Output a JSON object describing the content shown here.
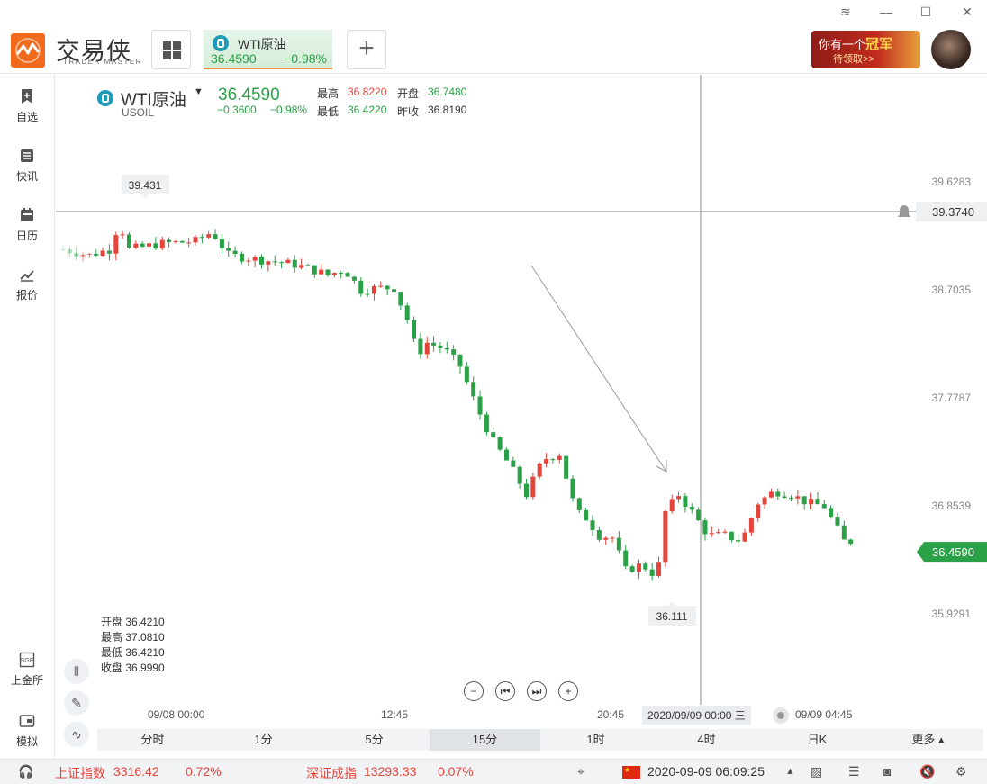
{
  "app": {
    "logo_cn": "交易侠",
    "logo_en": "TRADER MASTER"
  },
  "tab": {
    "name": "WTI原油",
    "price": "36.4590",
    "change_pct": "−0.98%"
  },
  "promo": {
    "line1_a": "你有一个",
    "line1_b": "冠军",
    "line2": "待领取>>"
  },
  "sidebar": {
    "items": [
      {
        "label": "自选",
        "icon": "bookmark-icon"
      },
      {
        "label": "快讯",
        "icon": "news-icon"
      },
      {
        "label": "日历",
        "icon": "calendar-icon"
      },
      {
        "label": "报价",
        "icon": "chart-line-icon"
      },
      {
        "label": "上金所",
        "icon": "sge-icon"
      },
      {
        "label": "模拟",
        "icon": "wallet-icon"
      }
    ]
  },
  "quote": {
    "name": "WTI原油",
    "symbol": "USOIL",
    "price": "36.4590",
    "change": "−0.3600",
    "change_pct": "−0.98%",
    "high_label": "最高",
    "high": "36.8220",
    "open_label": "开盘",
    "open": "36.7480",
    "low_label": "最低",
    "low": "36.4220",
    "prev_label": "昨收",
    "prev": "36.8190"
  },
  "ohlc_panel": {
    "open": "开盘 36.4210",
    "high": "最高 37.0810",
    "low": "最低 36.4210",
    "close": "收盘 36.9990"
  },
  "chart": {
    "y_ticks": [
      "39.6283",
      "38.7035",
      "37.7787",
      "36.8539",
      "35.9291"
    ],
    "crosshair_price": "39.3740",
    "current_price": "36.4590",
    "max_label": "39.431",
    "min_label": "36.111",
    "x_labels": [
      "09/08 00:00",
      "12:45",
      "20:45",
      "09/09 04:45"
    ],
    "crosshair_time": "2020/09/09 00:00 三",
    "colors": {
      "up": "#e5443b",
      "down": "#2aa146"
    }
  },
  "chart_data": {
    "type": "candlestick",
    "title": "WTI原油",
    "ylim": [
      35.6,
      39.9
    ],
    "x": [
      "09/08 00:00",
      "12:45",
      "20:45",
      "09/09 04:45"
    ],
    "price_max": 39.431,
    "price_min": 36.111,
    "last": 36.459
  },
  "periods": [
    "分时",
    "1分",
    "5分",
    "15分",
    "1时",
    "4时",
    "日K",
    "更多"
  ],
  "active_period": "15分",
  "status": {
    "idx1_name": "上证指数",
    "idx1_val": "3316.42",
    "idx1_pct": "0.72%",
    "idx2_name": "深证成指",
    "idx2_val": "13293.33",
    "idx2_pct": "0.07%",
    "datetime": "2020-09-09 06:09:25"
  }
}
